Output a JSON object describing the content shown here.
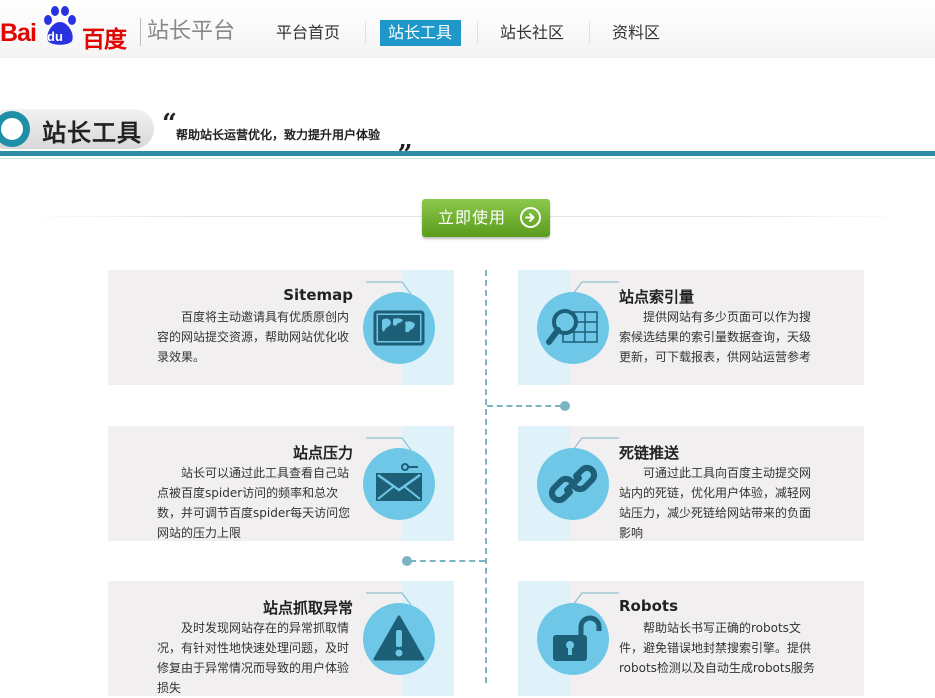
{
  "header": {
    "logo_bai": "Bai",
    "logo_du": "du",
    "logo_cn": "百度",
    "site_title": "站长平台",
    "nav": [
      {
        "label": "平台首页",
        "active": false
      },
      {
        "label": "站长工具",
        "active": true
      },
      {
        "label": "站长社区",
        "active": false
      },
      {
        "label": "资料区",
        "active": false
      }
    ]
  },
  "banner": {
    "title": "站长工具",
    "quote_open": "“",
    "slogan": "帮助站长运营优化，致力提升用户体验",
    "quote_close": "„"
  },
  "use_button": {
    "label": "立即使用",
    "icon": "arrow-right-circle-icon"
  },
  "colors": {
    "brand_red": "#e10602",
    "nav_active": "#1e97c9",
    "teal": "#2b8ea4",
    "icon_circle": "#6ec7e6",
    "button_green": "#6fb02e"
  },
  "tools": [
    {
      "title": "Sitemap",
      "icon": "world-map-icon",
      "desc": "百度将主动邀请具有优质原创内容的网站提交资源，帮助网站优化收录效果。"
    },
    {
      "title": "站点索引量",
      "icon": "magnifier-grid-icon",
      "desc": "提供网站有多少页面可以作为搜索候选结果的索引量数据查询，天级更新，可下载报表，供网站运营参考"
    },
    {
      "title": "站点压力",
      "icon": "envelope-icon",
      "desc": "站长可以通过此工具查看自己站点被百度spider访问的频率和总次数，并可调节百度spider每天访问您网站的压力上限"
    },
    {
      "title": "死链推送",
      "icon": "chain-link-icon",
      "desc": "可通过此工具向百度主动提交网站内的死链，优化用户体验，减轻网站压力，减少死链给网站带来的负面影响"
    },
    {
      "title": "站点抓取异常",
      "icon": "warning-triangle-icon",
      "desc": "及时发现网站存在的异常抓取情况，有针对性地快速处理问题，及时修复由于异常情况而导致的用户体验损失"
    },
    {
      "title": "Robots",
      "icon": "open-lock-icon",
      "desc": "帮助站长书写正确的robots文件，避免错误地封禁搜索引擎。提供robots检测以及自动生成robots服务"
    }
  ]
}
